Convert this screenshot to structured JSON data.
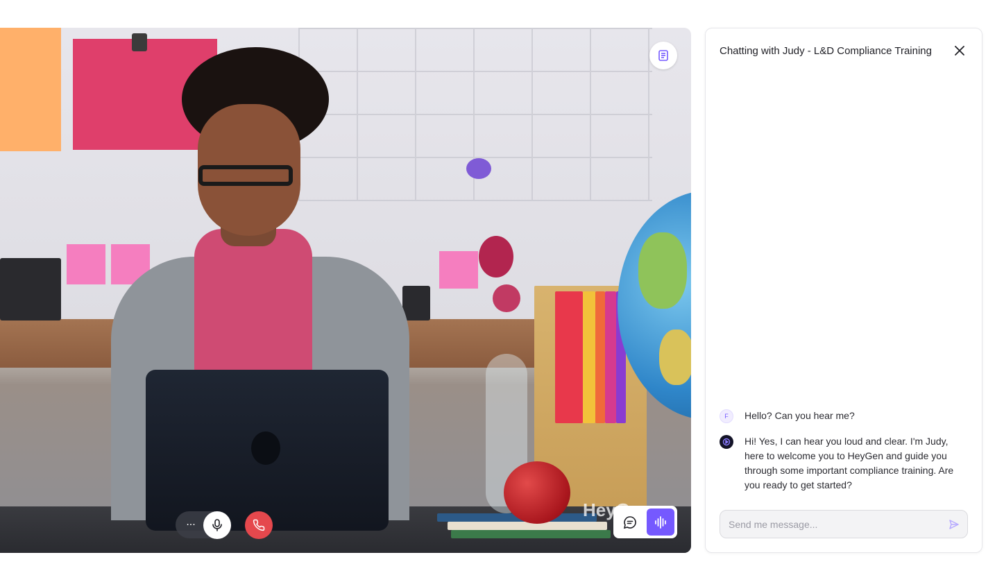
{
  "video": {
    "watermark": "HeyG",
    "controls": {
      "more_label": "···",
      "more_icon": "ellipsis-icon",
      "mic_icon": "microphone-icon",
      "hangup_icon": "phone-hangup-icon",
      "transcript_icon": "transcript-icon",
      "chat_mode_icon": "chat-bubble-icon",
      "voice_mode_icon": "audio-waveform-icon"
    },
    "colors": {
      "accent": "#7559ff",
      "hangup": "#e5484d"
    }
  },
  "chat_panel": {
    "title": "Chatting with Judy - L&D Compliance Training",
    "close_icon": "close-icon",
    "messages": [
      {
        "sender": "user",
        "avatar_letter": "F",
        "text": "Hello? Can you hear me?"
      },
      {
        "sender": "avatar",
        "avatar_icon": "heygen-logo-icon",
        "text": "Hi! Yes, I can hear you loud and clear. I'm Judy, here to welcome you to HeyGen and guide you through some important compliance training. Are you ready to get started?"
      }
    ],
    "input": {
      "value": "",
      "placeholder": "Send me message..."
    },
    "send_icon": "send-icon"
  }
}
